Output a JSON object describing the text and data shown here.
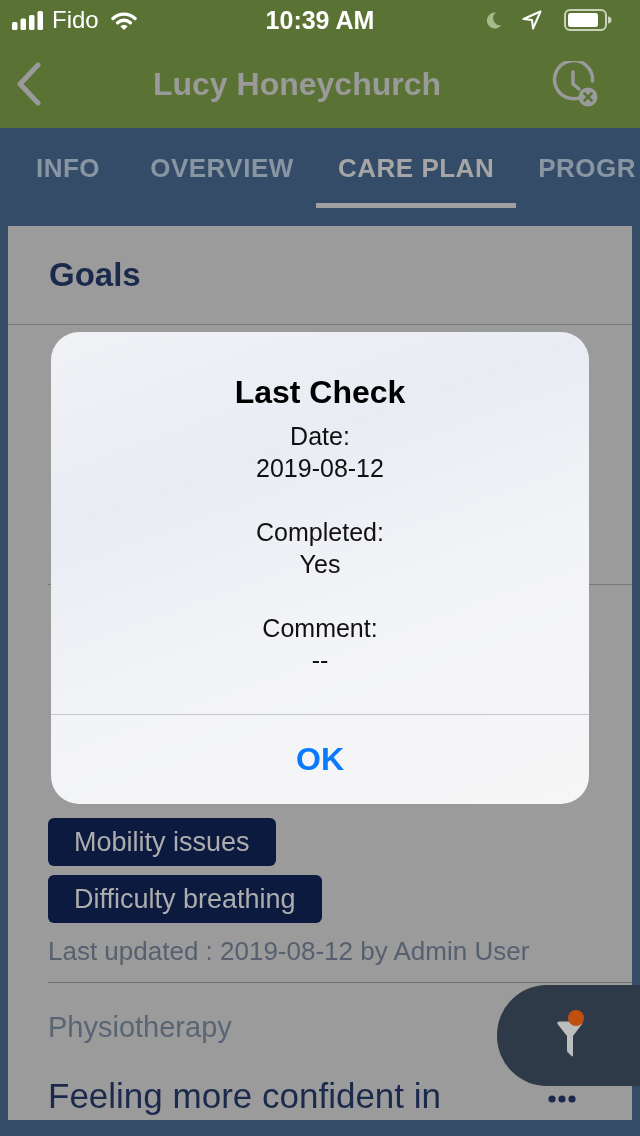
{
  "status_bar": {
    "carrier": "Fido",
    "time": "10:39 AM"
  },
  "nav_bar": {
    "title": "Lucy Honeychurch"
  },
  "tabs": [
    {
      "label": "INFO",
      "selected": false
    },
    {
      "label": "OVERVIEW",
      "selected": false
    },
    {
      "label": "CARE PLAN",
      "selected": true
    },
    {
      "label": "PROGR",
      "selected": false
    }
  ],
  "section": {
    "title": "Goals"
  },
  "goal": {
    "tags": [
      {
        "label": "Mobility issues"
      },
      {
        "label": "Difficulty breathing"
      }
    ],
    "last_updated": "Last updated : 2019-08-12 by Admin User"
  },
  "next_goal": {
    "category": "Physiotherapy",
    "title": "Feeling more confident in"
  },
  "filter_button": {
    "badge": true
  },
  "dialog": {
    "title": "Last Check",
    "fields": [
      {
        "label": "Date:",
        "value": "2019-08-12"
      },
      {
        "label": "Completed:",
        "value": "Yes"
      },
      {
        "label": "Comment:",
        "value": "--"
      }
    ],
    "button": "OK"
  }
}
